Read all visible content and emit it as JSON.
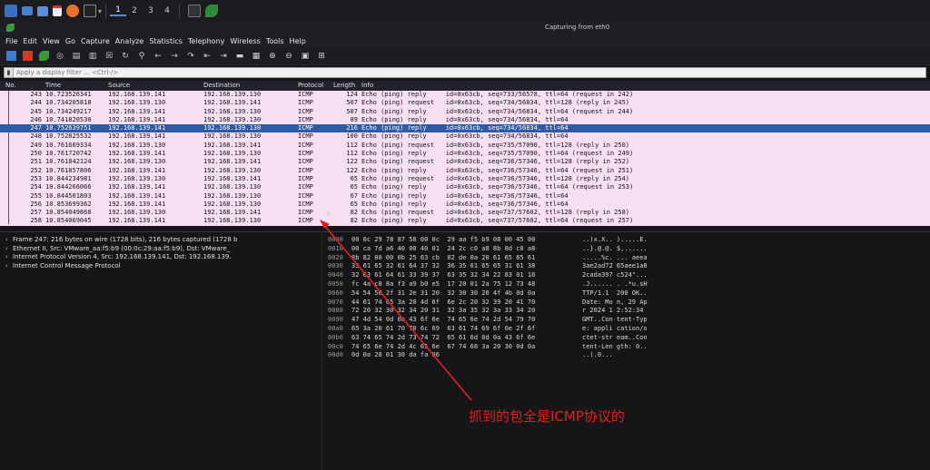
{
  "taskbar": {
    "workspaces": [
      "1",
      "2",
      "3",
      "4"
    ]
  },
  "window": {
    "title": "Capturing from eth0"
  },
  "menu": [
    "File",
    "Edit",
    "View",
    "Go",
    "Capture",
    "Analyze",
    "Statistics",
    "Telephony",
    "Wireless",
    "Tools",
    "Help"
  ],
  "filter": {
    "placeholder": "Apply a display filter ... <Ctrl-/>"
  },
  "columns": {
    "no": "No.",
    "time": "Time",
    "source": "Source",
    "destination": "Destination",
    "protocol": "Protocol",
    "length": "Length",
    "info": "Info"
  },
  "packets": [
    {
      "no": "243",
      "time": "10.723526341",
      "src": "192.168.139.141",
      "dst": "192.168.139.130",
      "proto": "ICMP",
      "len": "124",
      "info": "Echo (ping) reply     id=0x63cb, seq=733/56578, ttl=64 (request in 242)"
    },
    {
      "no": "244",
      "time": "10.734205818",
      "src": "192.168.139.130",
      "dst": "192.168.139.141",
      "proto": "ICMP",
      "len": "507",
      "info": "Echo (ping) request   id=0x63cb, seq=734/56834, ttl=128 (reply in 245)"
    },
    {
      "no": "245",
      "time": "10.734249217",
      "src": "192.168.139.141",
      "dst": "192.168.139.130",
      "proto": "ICMP",
      "len": "507",
      "info": "Echo (ping) reply     id=0x63cb, seq=734/56834, ttl=64 (request in 244)"
    },
    {
      "no": "246",
      "time": "10.741820530",
      "src": "192.168.139.141",
      "dst": "192.168.139.130",
      "proto": "ICMP",
      "len": "89",
      "info": "Echo (ping) reply     id=0x63cb, seq=734/56834, ttl=64"
    },
    {
      "no": "247",
      "time": "10.752639751",
      "src": "192.168.139.141",
      "dst": "192.168.139.130",
      "proto": "ICMP",
      "len": "216",
      "info": "Echo (ping) reply     id=0x63cb, seq=734/56834, ttl=64"
    },
    {
      "no": "248",
      "time": "10.752825532",
      "src": "192.168.139.141",
      "dst": "192.168.139.130",
      "proto": "ICMP",
      "len": "100",
      "info": "Echo (ping) reply     id=0x63cb, seq=734/56834, ttl=64"
    },
    {
      "no": "249",
      "time": "10.761669334",
      "src": "192.168.139.130",
      "dst": "192.168.139.141",
      "proto": "ICMP",
      "len": "112",
      "info": "Echo (ping) request   id=0x63cb, seq=735/57090, ttl=128 (reply in 250)"
    },
    {
      "no": "250",
      "time": "10.761720742",
      "src": "192.168.139.141",
      "dst": "192.168.139.130",
      "proto": "ICMP",
      "len": "112",
      "info": "Echo (ping) reply     id=0x63cb, seq=735/57090, ttl=64 (request in 249)"
    },
    {
      "no": "251",
      "time": "10.761842124",
      "src": "192.168.139.130",
      "dst": "192.168.139.141",
      "proto": "ICMP",
      "len": "122",
      "info": "Echo (ping) request   id=0x63cb, seq=736/57346, ttl=128 (reply in 252)"
    },
    {
      "no": "252",
      "time": "10.761857806",
      "src": "192.168.139.141",
      "dst": "192.168.139.130",
      "proto": "ICMP",
      "len": "122",
      "info": "Echo (ping) reply     id=0x63cb, seq=736/57346, ttl=64 (request in 251)"
    },
    {
      "no": "253",
      "time": "10.844234981",
      "src": "192.168.139.130",
      "dst": "192.168.139.141",
      "proto": "ICMP",
      "len": "65",
      "info": "Echo (ping) request   id=0x63cb, seq=736/57346, ttl=128 (reply in 254)"
    },
    {
      "no": "254",
      "time": "10.844266066",
      "src": "192.168.139.141",
      "dst": "192.168.139.130",
      "proto": "ICMP",
      "len": "65",
      "info": "Echo (ping) reply     id=0x63cb, seq=736/57346, ttl=64 (request in 253)"
    },
    {
      "no": "255",
      "time": "10.844501803",
      "src": "192.168.139.141",
      "dst": "192.168.139.130",
      "proto": "ICMP",
      "len": "67",
      "info": "Echo (ping) reply     id=0x63cb, seq=736/57346, ttl=64"
    },
    {
      "no": "256",
      "time": "10.853699362",
      "src": "192.168.139.141",
      "dst": "192.168.139.130",
      "proto": "ICMP",
      "len": "65",
      "info": "Echo (ping) reply     id=0x63cb, seq=736/57346, ttl=64"
    },
    {
      "no": "257",
      "time": "10.854049868",
      "src": "192.168.139.130",
      "dst": "192.168.139.141",
      "proto": "ICMP",
      "len": "82",
      "info": "Echo (ping) request   id=0x63cb, seq=737/57602, ttl=128 (reply in 258)"
    },
    {
      "no": "258",
      "time": "10.854069045",
      "src": "192.168.139.141",
      "dst": "192.168.139.130",
      "proto": "ICMP",
      "len": "82",
      "info": "Echo (ping) reply     id=0x63cb, seq=737/57602, ttl=64 (request in 257)"
    }
  ],
  "selected_packet": "247",
  "details": [
    "Frame 247: 216 bytes on wire (1728 bits), 216 bytes captured (1728 b",
    "Ethernet II, Src: VMware_aa:f5:b9 (00:0c:29:aa:f5:b9), Dst: VMware_",
    "Internet Protocol Version 4, Src: 192.168.139.141, Dst: 192.168.139.",
    "Internet Control Message Protocol"
  ],
  "bytes": [
    {
      "off": "0000",
      "hex": "00 0c 29 78 87 58 00 0c  29 aa f5 b9 08 00 45 00",
      "asc": "..)x.X.. ).....E."
    },
    {
      "off": "0010",
      "hex": "00 ca 7d a6 40 00 40 01  24 2c c0 a8 8b 8d c0 a8",
      "asc": "..}.@.@. $,......"
    },
    {
      "off": "0020",
      "hex": "8b 82 00 00 0b 25 63 cb  02 de 0a 20 61 65 65 61",
      "asc": ".....%c. ... aeea"
    },
    {
      "off": "0030",
      "hex": "33 61 65 32 61 64 37 32  36 35 61 65 65 31 61 38",
      "asc": "3ae2ad72 65aee1a8"
    },
    {
      "off": "0040",
      "hex": "32 63 61 64 61 33 39 37  63 35 32 34 22 83 01 18",
      "asc": "2cada397 c524\"..."
    },
    {
      "off": "0050",
      "hex": "fc 4a c8 8a f3 a9 b0 e5  17 20 01 2a 75 12 73 48",
      "asc": ".J...... . .*u.sH"
    },
    {
      "off": "0060",
      "hex": "54 54 50 2f 31 2e 31 20  32 30 30 20 4f 4b 0d 0a",
      "asc": "TTP/1.1  200 OK.."
    },
    {
      "off": "0070",
      "hex": "44 61 74 65 3a 20 4d 6f  6e 2c 20 32 39 20 41 70",
      "asc": "Date: Mo n, 29 Ap"
    },
    {
      "off": "0080",
      "hex": "72 20 32 30 32 34 20 31  32 3a 35 32 3a 33 34 20",
      "asc": "r 2024 1 2:52:34 "
    },
    {
      "off": "0090",
      "hex": "47 4d 54 0d 0a 43 6f 6e  74 65 6e 74 2d 54 79 70",
      "asc": "GMT..Con tent-Typ"
    },
    {
      "off": "00a0",
      "hex": "65 3a 20 61 70 70 6c 69  63 61 74 69 6f 6e 2f 6f",
      "asc": "e: appli cation/o"
    },
    {
      "off": "00b0",
      "hex": "63 74 65 74 2d 73 74 72  65 61 6d 0d 0a 43 6f 6e",
      "asc": "ctet-str eam..Con"
    },
    {
      "off": "00c0",
      "hex": "74 65 6e 74 2d 4c 65 6e  67 74 68 3a 20 30 0d 0a",
      "asc": "tent-Len gth: 0.."
    },
    {
      "off": "00d0",
      "hex": "0d 0a 28 01 30 da fa 06",
      "asc": "..(.0..."
    }
  ],
  "annotation": {
    "text": "抓到的包全是ICMP协议的",
    "color": "#e02020"
  },
  "colors": {
    "row_bg": "#f7dff2",
    "selected_bg": "#2d5ba6"
  }
}
